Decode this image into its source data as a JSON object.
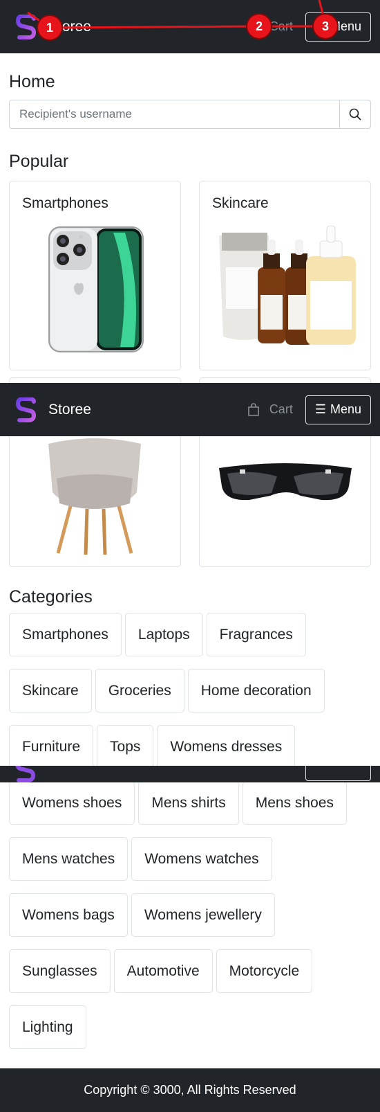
{
  "brand": {
    "name": "Storee"
  },
  "nav": {
    "cart_label": "Cart",
    "menu_label": "Menu",
    "menu_bars": "☰"
  },
  "home": {
    "title": "Home"
  },
  "search": {
    "placeholder": "Recipient's username"
  },
  "popular": {
    "title": "Popular",
    "cards": [
      {
        "title": "Smartphones"
      },
      {
        "title": "Skincare"
      }
    ]
  },
  "categories": {
    "title": "Categories",
    "items": [
      "Smartphones",
      "Laptops",
      "Fragrances",
      "Skincare",
      "Groceries",
      "Home decoration",
      "Furniture",
      "Tops",
      "Womens dresses",
      "Womens shoes",
      "Mens shirts",
      "Mens shoes",
      "Mens watches",
      "Womens watches",
      "Womens bags",
      "Womens jewellery",
      "Sunglasses",
      "Automotive",
      "Motorcycle",
      "Lighting"
    ]
  },
  "footer": {
    "text": "Copyright © 3000, All Rights Reserved"
  },
  "markers": [
    "1",
    "2",
    "3"
  ],
  "colors": {
    "navbar": "#212529",
    "brand_gradient": [
      "#7b3fe4",
      "#c25ae0"
    ],
    "marker": "#e8141c"
  }
}
